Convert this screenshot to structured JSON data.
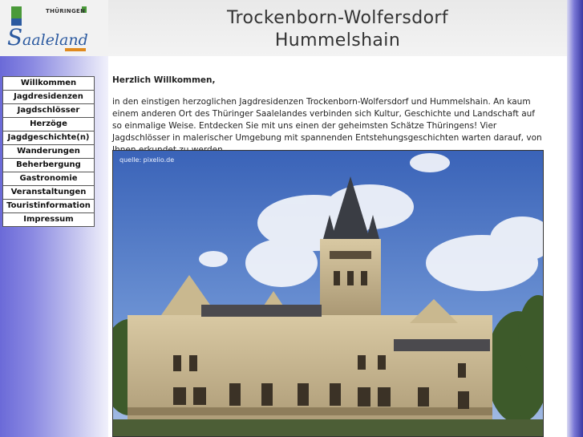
{
  "logo": {
    "region_text": "THÜRINGEN",
    "brand_text": "Saaleland"
  },
  "header": {
    "title_line1": "Trockenborn-Wolfersdorf",
    "title_line2": "Hummelshain"
  },
  "nav": {
    "items": [
      {
        "label": "Willkommen"
      },
      {
        "label": "Jagdresidenzen"
      },
      {
        "label": "Jagdschlösser"
      },
      {
        "label": "Herzöge"
      },
      {
        "label": "Jagdgeschichte(n)"
      },
      {
        "label": "Wanderungen"
      },
      {
        "label": "Beherbergung"
      },
      {
        "label": "Gastronomie"
      },
      {
        "label": "Veranstaltungen"
      },
      {
        "label": "Touristinformation"
      },
      {
        "label": "Impressum"
      }
    ]
  },
  "main": {
    "greeting": "Herzlich Willkommen,",
    "intro": "in den einstigen herzoglichen Jagdresidenzen Trockenborn-Wolfersdorf und Hummelshain. An kaum einem anderen Ort des Thüringer Saalelandes verbinden sich Kultur, Geschichte und Landschaft auf so einmalige Weise. Entdecken Sie mit uns einen der geheimsten Schätze Thüringens! Vier Jagdschlösser in malerischer Umgebung mit spannenden Entstehungsgeschichten warten darauf, von Ihnen erkundet zu werden.",
    "photo_credit": "quelle: pixelio.de"
  },
  "colors": {
    "accent": "#6b6ad8",
    "logo_green": "#4a9a3a",
    "logo_blue": "#2c5aa0",
    "logo_orange": "#e08a1e"
  }
}
